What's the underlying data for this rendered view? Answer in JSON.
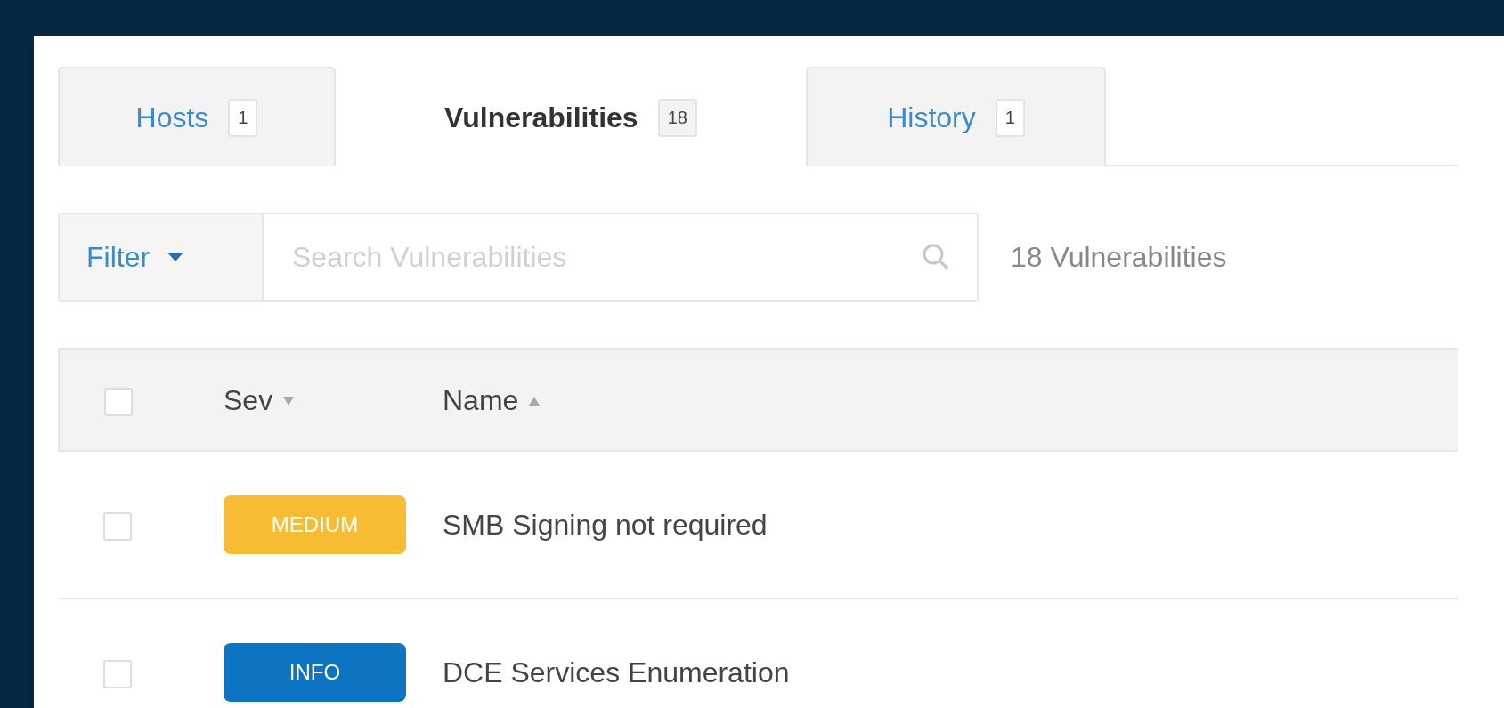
{
  "tabs": [
    {
      "label": "Hosts",
      "count": "1",
      "selected": false
    },
    {
      "label": "Vulnerabilities",
      "count": "18",
      "selected": true
    },
    {
      "label": "History",
      "count": "1",
      "selected": false
    }
  ],
  "toolbar": {
    "filter_label": "Filter",
    "search": {
      "placeholder": "Search Vulnerabilities"
    },
    "result_count": "18 Vulnerabilities"
  },
  "table": {
    "select_all_checked": false,
    "columns": [
      {
        "label": "Sev",
        "sort_ascending": false
      },
      {
        "label": "Name",
        "sort_ascending": true
      }
    ],
    "rows": [
      {
        "checked": false,
        "severity": "MEDIUM",
        "color": "#f6bd34",
        "name": "SMB Signing not required"
      },
      {
        "checked": false,
        "severity": "INFO",
        "color": "#0c74c0",
        "name": "DCE Services Enumeration"
      }
    ]
  }
}
